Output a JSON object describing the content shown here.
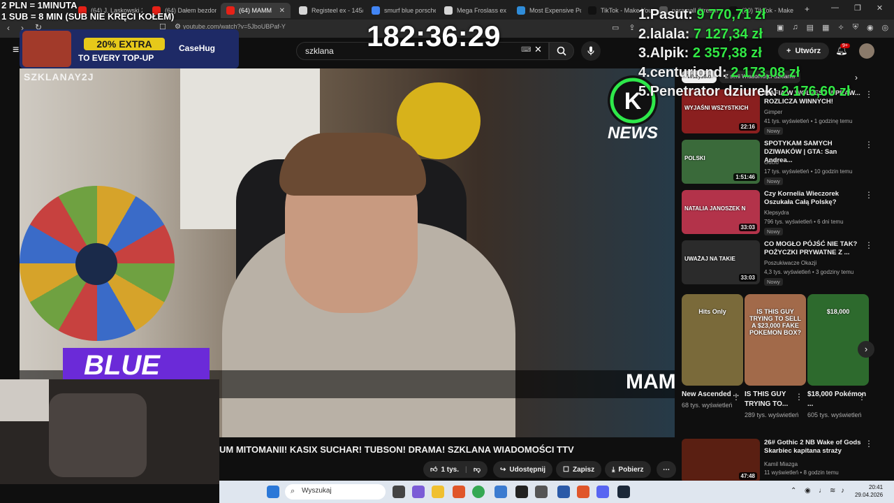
{
  "browser": {
    "tabs": [
      {
        "label": "(64) J. Laskowski 2P",
        "color": "#e62117"
      },
      {
        "label": "(64) Dałem bezdom",
        "color": "#e62117"
      },
      {
        "label": "(64) MAMM",
        "color": "#e62117"
      },
      {
        "label": "Registeel ex - 145/2",
        "color": "#d6d6d6"
      },
      {
        "label": "smurf blue porsche",
        "color": "#4285f4"
      },
      {
        "label": "Mega Froslass ex -",
        "color": "#d6d6d6"
      },
      {
        "label": "Most Expensive Pok",
        "color": "#2f8cd8"
      },
      {
        "label": "TikTok - Make Your",
        "color": "#111111"
      },
      {
        "label": "paramall Stream",
        "color": "#555555"
      },
      {
        "label": "(20) TikTok - Make",
        "color": "#111111"
      }
    ],
    "url": "youtube.com/watch?v=5JboUBPaf-Y"
  },
  "youtube": {
    "search_value": "szklana",
    "create_label": "Utwórz",
    "notif_badge": "9+",
    "video_title": "UM MITOMANII! KASIX SUCHAR! TUBSON! DRAMA! SZKLANA WIADOMOŚCI TTV",
    "likes": "1 tys.",
    "share_label": "Udostępnij",
    "save_label": "Zapisz",
    "download_label": "Pobierz",
    "marquee_text": "MAM",
    "watermark": "SZKLANAY2J",
    "news_label": "NEWS",
    "blue_label": "BLUE"
  },
  "chips": {
    "first": "Wszystko",
    "second": "Z serii Wiadomości Szklania"
  },
  "sidebar": {
    "videos": [
      {
        "title": "MAFIA W WOLVES? WPRAW... ROZLICZA WINNYCH!",
        "channel": "Gimper",
        "meta": "41 tys. wyświetleń • 1 godzinę temu",
        "badge": "Nowy",
        "duration": "22:16",
        "thumb_label": "WYJAŚNI WSZYSTKICH",
        "color": "#8a1f1f"
      },
      {
        "title": "SPOTYKAM SAMYCH DZIWAKÓW | GTA: San Andrea...",
        "channel": "Gucio",
        "meta": "17 tys. wyświetleń • 10 godzin temu",
        "badge": "Nowy",
        "duration": "1:51:46",
        "thumb_label": "POLSKI",
        "color": "#3a6a3a"
      },
      {
        "title": "Czy Kornelia Wieczorek Oszukała Całą Polskę?",
        "channel": "Klepsydra",
        "meta": "796 tys. wyświetleń • 6 dni temu",
        "badge": "Nowy",
        "duration": "33:03",
        "thumb_label": "NATALIA JANOSZEK N",
        "color": "#b3334a"
      },
      {
        "title": "CO MOGŁO PÓJŚĆ NIE TAK? POŻYCZKI PRYWATNE Z ...",
        "channel": "Poszukiwacze Okazji",
        "meta": "4,3 tys. wyświetleń • 3 godziny temu",
        "badge": "Nowy",
        "duration": "33:03",
        "thumb_label": "UWAŻAJ NA TAKIE",
        "color": "#2b2b2b"
      }
    ],
    "shorts": [
      {
        "title": "New Ascended ...",
        "views": "68 tys. wyświetleń",
        "thumb_label": "Hits Only",
        "color": "#7a6a3a"
      },
      {
        "title": "IS THIS GUY TRYING TO...",
        "views": "289 tys. wyświetleń",
        "thumb_label": "IS THIS GUY TRYING TO SELL A $23,000 FAKE POKEMON BOX?",
        "color": "#a26a4a"
      },
      {
        "title": "$18,000 Pokémon ...",
        "views": "605 tys. wyświetleń",
        "thumb_label": "$18,000",
        "color": "#2d6a2d"
      }
    ],
    "last_video": {
      "title": "26# Gothic 2 NB Wake of Gods Skarbiec kapitana straży",
      "channel": "Kamil Miazga",
      "meta": "11 wyświetleń • 8 godzin temu",
      "duration": "47:48",
      "color": "#5a1f12"
    }
  },
  "stream_overlay": {
    "pln_rule": "2 PLN =  1MINUTA",
    "sub_rule": "1 SUB = 8 MIN (SUB NIE KRĘCI KOŁEM)",
    "timer": "182:36:29",
    "promo_extra": "20% EXTRA",
    "promo_sub": "TO EVERY TOP-UP",
    "promo_brand": "CaseHug",
    "leaderboard": [
      {
        "rank": "1.",
        "name": "Pasut:",
        "amount": "9 770,71 zł"
      },
      {
        "rank": "2.",
        "name": "lalala:",
        "amount": "7 127,34 zł"
      },
      {
        "rank": "3.",
        "name": "Alpik:",
        "amount": "2 357,38 zł"
      },
      {
        "rank": "4.",
        "name": "centuriond:",
        "amount": "2 173,08 zł"
      },
      {
        "rank": "5.",
        "name": "Penetrator dziurek:",
        "amount": "2 176,60 zł"
      }
    ]
  },
  "taskbar": {
    "search_placeholder": "Wyszukaj",
    "time": "20:41",
    "date": "29.04.2026"
  }
}
